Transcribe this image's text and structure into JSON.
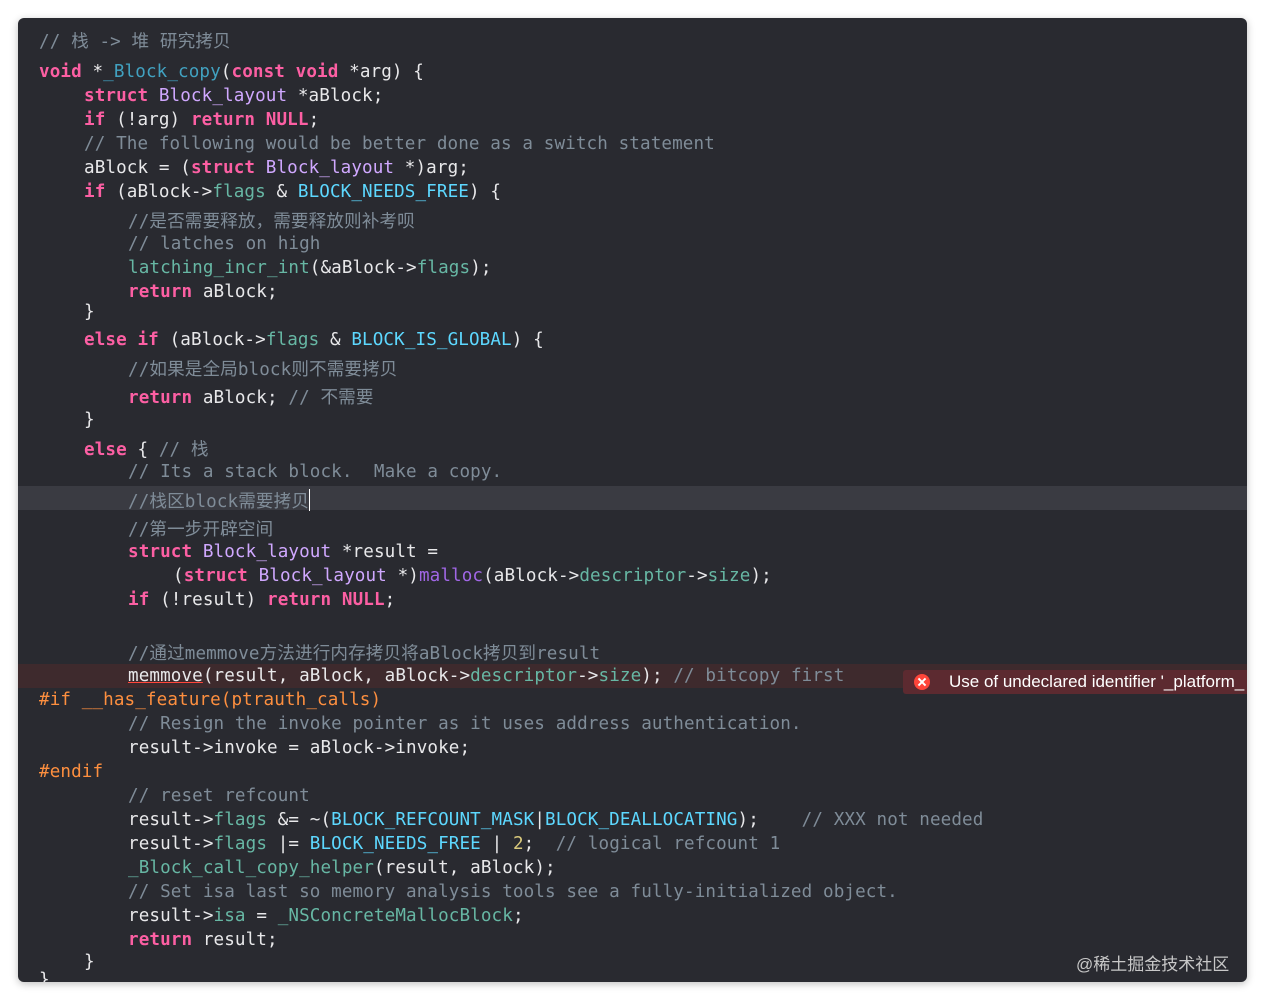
{
  "editor": {
    "error_message": "Use of undeclared identifier '_platform_",
    "line_texts": [
      "// 栈 -> 堆 研究拷贝",
      "void *_Block_copy(const void *arg) {",
      "struct Block_layout *aBlock;",
      "if (!arg) return NULL;",
      "// The following would be better done as a switch statement",
      "aBlock = (struct Block_layout *)arg;",
      "if (aBlock->flags & BLOCK_NEEDS_FREE) {",
      "//是否需要释放，需要释放则补考呗",
      "// latches on high",
      "latching_incr_int(&aBlock->flags);",
      "return aBlock;",
      "}",
      "else if (aBlock->flags & BLOCK_IS_GLOBAL) {",
      "//如果是全局block则不需要拷贝",
      "return aBlock; // 不需要",
      "}",
      "else { // 栈",
      "// Its a stack block.  Make a copy.",
      "//栈区block需要拷贝",
      "//第一步开辟空间",
      "struct Block_layout *result =",
      "(struct Block_layout *)malloc(aBlock->descriptor->size);",
      "if (!result) return NULL;",
      "",
      "//通过memmove方法进行内存拷贝将aBlock拷贝到result",
      "memmove(result, aBlock, aBlock->descriptor->size); // bitcopy first",
      "#if __has_feature(ptrauth_calls)",
      "// Resign the invoke pointer as it uses address authentication.",
      "result->invoke = aBlock->invoke;",
      "#endif",
      "// reset refcount",
      "result->flags &= ~(BLOCK_REFCOUNT_MASK|BLOCK_DEALLOCATING);    // XXX not needed",
      "result->flags |= BLOCK_NEEDS_FREE | 2;  // logical refcount 1",
      "_Block_call_copy_helper(result, aBlock);",
      "// Set isa last so memory analysis tools see a fully-initialized object.",
      "result->isa = _NSConcreteMallocBlock;",
      "return result;",
      "}",
      "}"
    ]
  },
  "watermark": "@稀土掘金技术社区",
  "icons": {
    "error": "error-x-circle-icon"
  },
  "colors": {
    "background": "#292a30",
    "keyword": "#fc5fa3",
    "comment": "#7f8c98",
    "type": "#d0a8ff",
    "function": "#41a1c0",
    "member": "#67b7a4",
    "macro": "#5dd8ff",
    "preprocessor": "#fd8f3f",
    "number": "#d9c97c",
    "error": "#ff453a",
    "current_line": "#3a3b42"
  }
}
